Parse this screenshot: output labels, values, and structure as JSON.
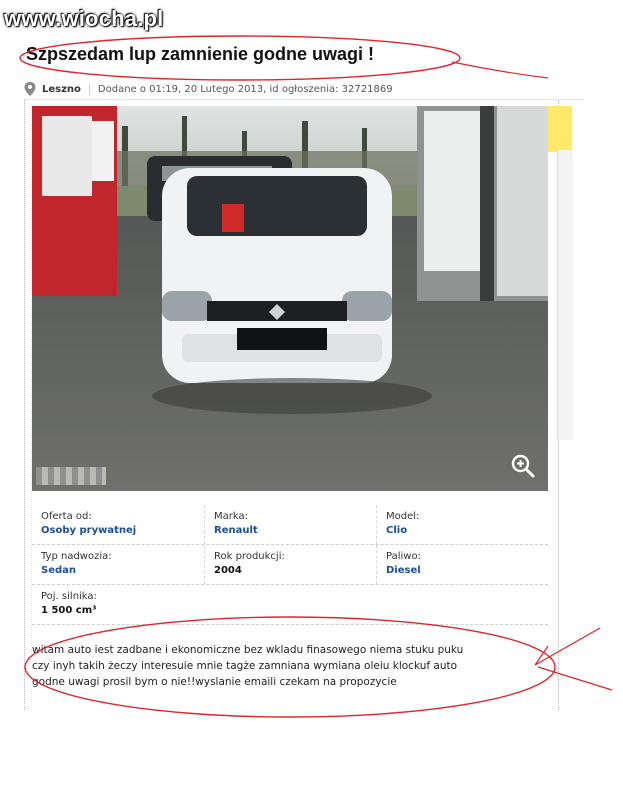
{
  "watermark": "www.wiocha.pl",
  "listing": {
    "title": "Szpszedam lup zamnienie godne uwagi !",
    "city": "Leszno",
    "added": "Dodane o 01:19, 20 Lutego 2013, id ogłoszenia: 32721869"
  },
  "photo": {
    "zoom_icon": "magnifier-plus-icon"
  },
  "details": {
    "rows": [
      [
        {
          "label": "Oferta od:",
          "value": "Osoby prywatnej",
          "link": true
        },
        {
          "label": "Marka:",
          "value": "Renault",
          "link": true
        },
        {
          "label": "Model:",
          "value": "Clio",
          "link": true
        }
      ],
      [
        {
          "label": "Typ nadwozia:",
          "value": "Sedan",
          "link": true
        },
        {
          "label": "Rok produkcji:",
          "value": "2004",
          "link": false
        },
        {
          "label": "Paliwo:",
          "value": "Diesel",
          "link": true
        }
      ],
      [
        {
          "label": "Poj. silnika:",
          "value": "1 500 cm³",
          "link": false
        }
      ]
    ]
  },
  "description": {
    "lines": [
      "witam auto iest zadbane i ekonomiczne bez wkladu finasowego niema stuku puku",
      "czy inyh takih żeczy interesuie mnie tagże zamniana wymiana oleiu klockuf auto",
      "godne uwagi prosil bym o nie!!wyslanie emaili czekam na propozycie"
    ]
  },
  "colors": {
    "link": "#1a4d9c",
    "annotation": "#e0242b"
  }
}
